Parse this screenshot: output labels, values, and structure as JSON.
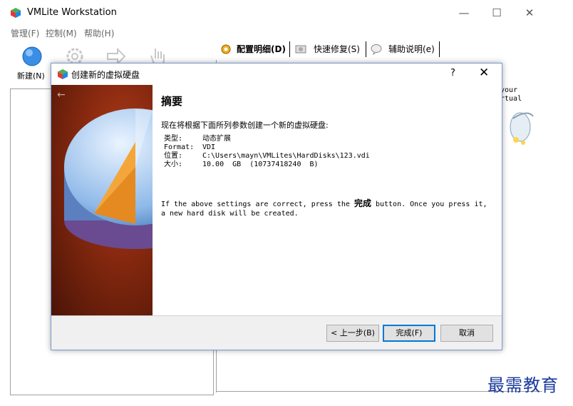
{
  "window": {
    "title": "VMLite Workstation",
    "minimize_symbol": "—",
    "maximize_symbol": "☐",
    "close_symbol": "✕"
  },
  "menu": [
    "管理(F)",
    "控制(M)",
    "帮助(H)"
  ],
  "toolbar": {
    "new_label": "新建(N)"
  },
  "tabs": [
    {
      "label": "配置明细(D)",
      "icon": "gear-icon"
    },
    {
      "label": "快速修复(S)",
      "icon": "snapshot-icon"
    },
    {
      "label": "辅助说明(e)",
      "icon": "help-bubble-icon"
    }
  ],
  "right_panel": {
    "text_line1": "your",
    "text_line2": "rtual"
  },
  "watermark": "最需教育",
  "dialog": {
    "title": "创建新的虚拟硬盘",
    "help": "?",
    "close": "✕",
    "back_arrow": "←",
    "heading": "摘要",
    "intro": "现在将根据下面所列参数创建一个新的虚拟硬盘:",
    "rows": [
      {
        "label": "类型:",
        "value": "动态扩展"
      },
      {
        "label": "Format:",
        "value": "VDI"
      },
      {
        "label": "位置:",
        "value": "C:\\Users\\mayn\\VMLites\\HardDisks\\123.vdi"
      },
      {
        "label": "大小:",
        "value": "10.00  GB  (10737418240  B)"
      }
    ],
    "note_before": "If the above settings are correct, press the ",
    "note_bold": "完成",
    "note_after": " button. Once you press it, a new hard disk will be created.",
    "buttons": {
      "back": "< 上一步(B)",
      "finish": "完成(F)",
      "cancel": "取消"
    }
  }
}
